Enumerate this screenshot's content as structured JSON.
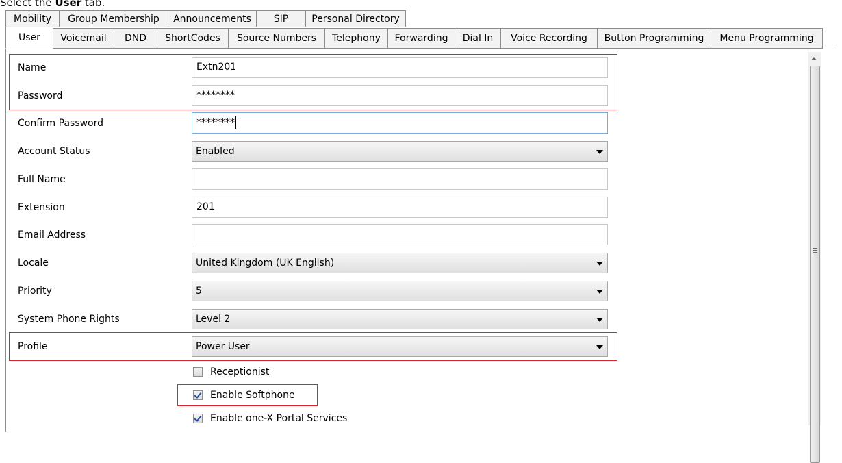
{
  "caption": {
    "pre": "Select the ",
    "bold": "User",
    "post": " tab."
  },
  "tabs_row1": [
    "Mobility",
    "Group Membership",
    "Announcements",
    "SIP",
    "Personal Directory"
  ],
  "tabs_row2": [
    "User",
    "Voicemail",
    "DND",
    "ShortCodes",
    "Source Numbers",
    "Telephony",
    "Forwarding",
    "Dial In",
    "Voice Recording",
    "Button Programming",
    "Menu Programming"
  ],
  "active_tab": "User",
  "form": {
    "name_label": "Name",
    "name_value": "Extn201",
    "password_label": "Password",
    "password_value": "********",
    "confirm_label": "Confirm Password",
    "confirm_value": "********",
    "account_status_label": "Account Status",
    "account_status_value": "Enabled",
    "full_name_label": "Full Name",
    "full_name_value": "",
    "extension_label": "Extension",
    "extension_value": "201",
    "email_label": "Email Address",
    "email_value": "",
    "locale_label": "Locale",
    "locale_value": "United Kingdom (UK English)",
    "priority_label": "Priority",
    "priority_value": "5",
    "rights_label": "System Phone Rights",
    "rights_value": "Level 2",
    "profile_label": "Profile",
    "profile_value": "Power User"
  },
  "checkboxes": {
    "receptionist": {
      "label": "Receptionist",
      "checked": false
    },
    "softphone": {
      "label": "Enable Softphone",
      "checked": true
    },
    "onex": {
      "label": "Enable one-X Portal Services",
      "checked": true
    }
  },
  "colors": {
    "highlight": "#d9262c",
    "check": "#254fa0"
  }
}
